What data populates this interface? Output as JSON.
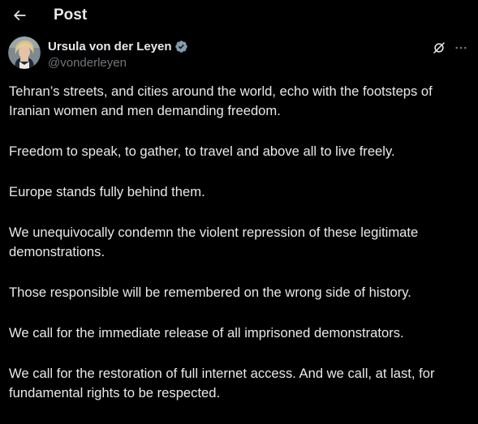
{
  "header": {
    "title": "Post",
    "back_icon": "arrow-left-icon"
  },
  "post": {
    "author": {
      "display_name": "Ursula von der Leyen",
      "handle": "@vonderleyen",
      "verified_icon": "verified-badge-icon",
      "verified_color": "#829aab"
    },
    "actions": {
      "grok_icon": "grok-icon",
      "more_icon": "more-horizontal-icon"
    },
    "paragraphs": [
      "Tehran’s streets, and cities around the world, echo with the footsteps of Iranian women and men demanding freedom.",
      "Freedom to speak, to gather, to travel and above all to live freely.",
      "Europe stands fully behind them.",
      "We unequivocally condemn the violent repression of these legitimate demonstrations.",
      "Those responsible will be remembered on the wrong side of history.",
      "We call for the immediate release of all imprisoned demonstrators.",
      "We call for the restoration of full internet access. And we call, at last, for fundamental rights to be respected."
    ]
  },
  "colors": {
    "background": "#000000",
    "text_primary": "#e7e9ea",
    "text_secondary": "#71767b"
  }
}
